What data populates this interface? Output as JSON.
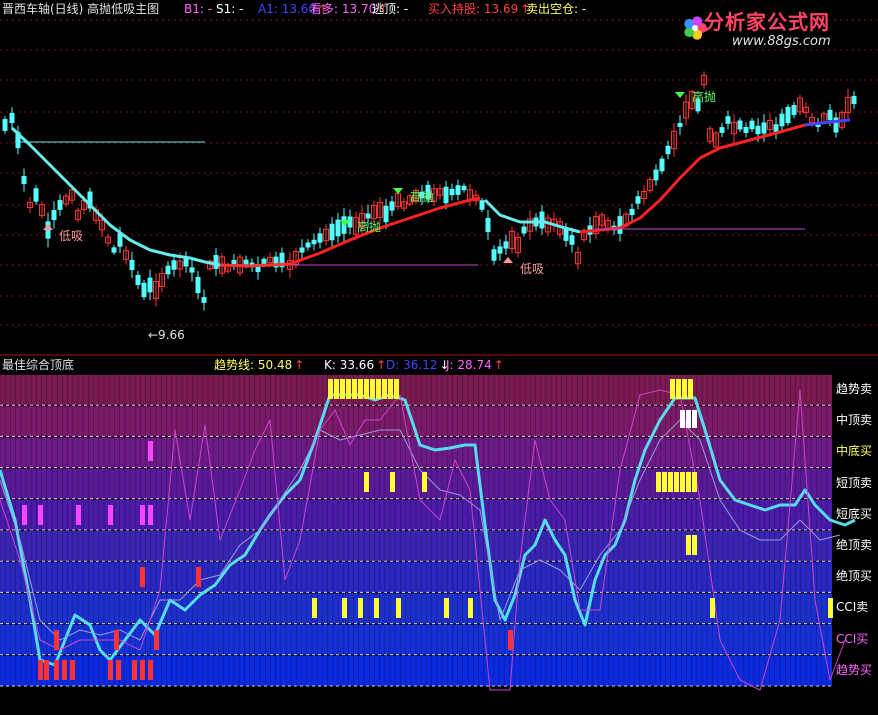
{
  "top_panel": {
    "title": "晋西车轴(日线) 高抛低吸主图",
    "indicators": [
      {
        "label": "B1: -",
        "color": "#ff66ff"
      },
      {
        "label": "S1: -",
        "color": "#ffffff"
      },
      {
        "label": "A1: 13.60",
        "color": "#4444ff"
      },
      {
        "label": "看多: 13.70",
        "color": "#ff66ff"
      },
      {
        "label": "逃顶: -",
        "color": "#ffffff"
      },
      {
        "label": "买入持股: 13.69",
        "color": "#ff4444"
      },
      {
        "label": "卖出空仓: -",
        "color": "#ffff66"
      }
    ],
    "annotations": {
      "low_buy": "低吸",
      "high_sell": "高抛",
      "price_low": "←9.66"
    }
  },
  "bottom_panel": {
    "title": "最佳综合顶底",
    "indicators": [
      {
        "label": "趋势线: 50.48",
        "color": "#ffff66"
      },
      {
        "label": "K: 33.66",
        "color": "#ffffff"
      },
      {
        "label": "D: 36.12",
        "color": "#4444ff"
      },
      {
        "label": "J: 28.74",
        "color": "#ff66ff"
      }
    ],
    "band_labels": [
      {
        "text": "趋势卖",
        "color": "#ffffff"
      },
      {
        "text": "中顶卖",
        "color": "#ffffff"
      },
      {
        "text": "中底买",
        "color": "#ffff66"
      },
      {
        "text": "短顶卖",
        "color": "#ffffff"
      },
      {
        "text": "短底买",
        "color": "#ffffff"
      },
      {
        "text": "绝顶卖",
        "color": "#ffffff"
      },
      {
        "text": "绝顶买",
        "color": "#ffffff"
      },
      {
        "text": "CCI卖",
        "color": "#ffffff"
      },
      {
        "text": "CCI买",
        "color": "#ff66ff"
      },
      {
        "text": "趋势买",
        "color": "#ff66ff"
      }
    ],
    "band_colors": [
      "#7a1a52",
      "#7a1a68",
      "#6b1a86",
      "#5a1a98",
      "#4a1aa8",
      "#3a24b4",
      "#2a28c0",
      "#1e30cc",
      "#1630d8",
      "#0c2ae0"
    ]
  },
  "watermark": {
    "brand": "分析家公式网",
    "url": "www.88gs.com"
  }
}
